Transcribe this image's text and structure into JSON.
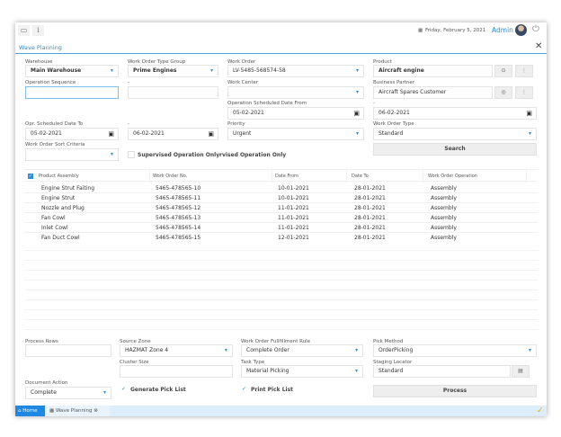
{
  "header": {
    "date": "Friday, February 5, 2021",
    "user": "Admin"
  },
  "tab_title": "Wave Planning",
  "filters": {
    "warehouse": {
      "label": "Warehouse",
      "value": "Main Warehouse"
    },
    "wo_type_group": {
      "label": "Work Order Type Group",
      "value": "Prime Engines"
    },
    "work_order": {
      "label": "Work Order",
      "value": "LV-5485-568574-58"
    },
    "product": {
      "label": "Product",
      "value": "Aircraft engine"
    },
    "op_sequence": {
      "label": "Operation Sequence",
      "value": ""
    },
    "op_sequence_to": {
      "label": "-",
      "value": ""
    },
    "work_center": {
      "label": "Work Center",
      "value": ""
    },
    "business_partner": {
      "label": "Business Partner",
      "value": "Aircraft Spares Customer"
    },
    "op_sched_from": {
      "label": "Operation Scheduled Date From",
      "value": "05-02-2021"
    },
    "op_sched_from_to": {
      "label": "-",
      "value": "06-02-2021"
    },
    "opr_sched_to": {
      "label": "Opr. Scheduled Date To",
      "value": "05-02-2021"
    },
    "opr_sched_to_to": {
      "label": "-",
      "value": "06-02-2021"
    },
    "priority": {
      "label": "Priority",
      "value": "Urgent"
    },
    "wo_type": {
      "label": "Work Order Type",
      "value": "Standard"
    },
    "sort_criteria": {
      "label": "Work Order Sort Criteria",
      "value": ""
    },
    "supervised": "Supervised Operation Only",
    "supervised2": "rvised Operation Only",
    "search": "Search"
  },
  "table": {
    "columns": [
      "Product Assembly",
      "Work Order No.",
      "Date From",
      "Date To",
      "Work Order Operation"
    ],
    "rows": [
      [
        "Engine Strut Faiting",
        "5465-478565-10",
        "10-01-2021",
        "28-01-2021",
        "Assembly"
      ],
      [
        "Engine Strut",
        "5465-478565-11",
        "10-01-2021",
        "28-01-2021",
        "Assembly"
      ],
      [
        "Nozzle and Plug",
        "5465-478565-12",
        "11-01-2021",
        "28-01-2021",
        "Assembly"
      ],
      [
        "Fan Cowl",
        "5465-478565-13",
        "11-01-2021",
        "28-01-2021",
        "Assembly"
      ],
      [
        "Inlet Cowl",
        "5465-478565-14",
        "11-01-2021",
        "28-01-2021",
        "Assembly"
      ],
      [
        "Fan Duct Cowl",
        "5465-478565-15",
        "12-01-2021",
        "28-01-2021",
        "Assembly"
      ]
    ]
  },
  "process": {
    "process_rows": {
      "label": "Process Rows",
      "value": ""
    },
    "source_zone": {
      "label": "Source Zone",
      "value": "HAZMAT Zone 4"
    },
    "fulfillment_rule": {
      "label": "Work Order Fullfillment Rule",
      "value": "Complete Order"
    },
    "pick_method": {
      "label": "Pick Method",
      "value": "OrderPicking"
    },
    "cluster_size": {
      "label": "Cluster Size",
      "value": ""
    },
    "task_type": {
      "label": "Task Type",
      "value": "Material Picking"
    },
    "staging_locator": {
      "label": "Staging Locator",
      "value": "Standard"
    },
    "document_action": {
      "label": "Document Action",
      "value": "Complete"
    },
    "generate_pick_list": "Generate Pick List",
    "print_pick_list": "Print Pick List",
    "process_button": "Process"
  },
  "taskbar": {
    "home": "Home",
    "wave": "Wave Planning"
  },
  "colors": {
    "accent": "#2a8fd8",
    "taskbar": "#dceefb"
  }
}
